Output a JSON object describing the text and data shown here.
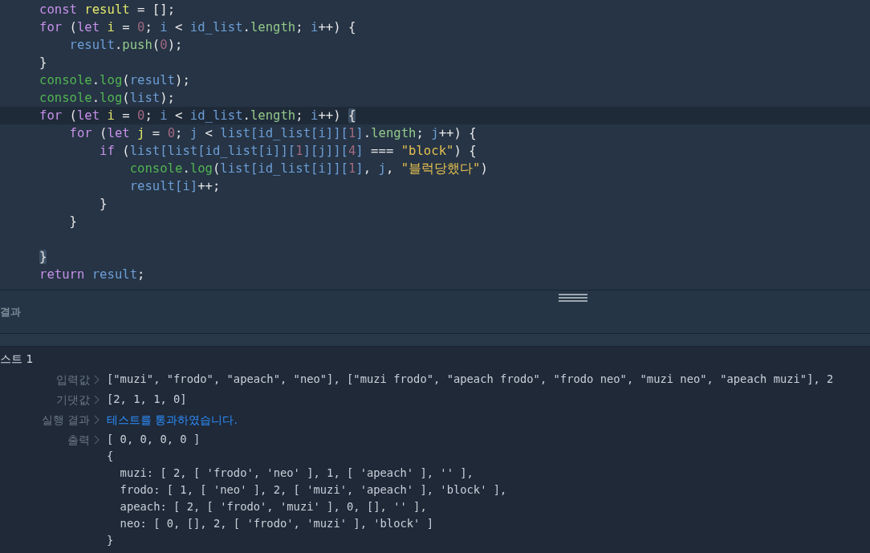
{
  "editor": {
    "lines": [
      {
        "active": false,
        "tokens": [
          {
            "kind": "kw",
            "text": "const "
          },
          {
            "kind": "decl",
            "text": "result"
          },
          {
            "kind": "op",
            "text": " = [];"
          }
        ]
      },
      {
        "active": false,
        "tokens": [
          {
            "kind": "kw",
            "text": "for"
          },
          {
            "kind": "op",
            "text": " ("
          },
          {
            "kind": "kw",
            "text": "let "
          },
          {
            "kind": "decl",
            "text": "i"
          },
          {
            "kind": "op",
            "text": " = "
          },
          {
            "kind": "num",
            "text": "0"
          },
          {
            "kind": "op",
            "text": "; "
          },
          {
            "kind": "id",
            "text": "i"
          },
          {
            "kind": "op",
            "text": " < "
          },
          {
            "kind": "id",
            "text": "id_list"
          },
          {
            "kind": "op",
            "text": "."
          },
          {
            "kind": "prop",
            "text": "length"
          },
          {
            "kind": "op",
            "text": "; "
          },
          {
            "kind": "id",
            "text": "i"
          },
          {
            "kind": "op",
            "text": "++) {"
          }
        ]
      },
      {
        "active": false,
        "tokens": [
          {
            "kind": "id",
            "text": "    result"
          },
          {
            "kind": "op",
            "text": "."
          },
          {
            "kind": "prop",
            "text": "push"
          },
          {
            "kind": "op",
            "text": "("
          },
          {
            "kind": "num",
            "text": "0"
          },
          {
            "kind": "op",
            "text": ");"
          }
        ]
      },
      {
        "active": false,
        "tokens": [
          {
            "kind": "op",
            "text": "}"
          }
        ]
      },
      {
        "active": false,
        "tokens": [
          {
            "kind": "fn",
            "text": "console"
          },
          {
            "kind": "op",
            "text": "."
          },
          {
            "kind": "fn",
            "text": "log"
          },
          {
            "kind": "op",
            "text": "("
          },
          {
            "kind": "id",
            "text": "result"
          },
          {
            "kind": "op",
            "text": ");"
          }
        ]
      },
      {
        "active": false,
        "tokens": [
          {
            "kind": "fn",
            "text": "console"
          },
          {
            "kind": "op",
            "text": "."
          },
          {
            "kind": "fn",
            "text": "log"
          },
          {
            "kind": "op",
            "text": "("
          },
          {
            "kind": "id",
            "text": "list"
          },
          {
            "kind": "op",
            "text": ");"
          }
        ]
      },
      {
        "active": true,
        "tokens": [
          {
            "kind": "kw",
            "text": "for"
          },
          {
            "kind": "op",
            "text": " ("
          },
          {
            "kind": "kw",
            "text": "let "
          },
          {
            "kind": "decl",
            "text": "i"
          },
          {
            "kind": "op",
            "text": " = "
          },
          {
            "kind": "num",
            "text": "0"
          },
          {
            "kind": "op",
            "text": "; "
          },
          {
            "kind": "id",
            "text": "i"
          },
          {
            "kind": "op",
            "text": " < "
          },
          {
            "kind": "id",
            "text": "id_list"
          },
          {
            "kind": "op",
            "text": "."
          },
          {
            "kind": "prop",
            "text": "length"
          },
          {
            "kind": "op",
            "text": "; "
          },
          {
            "kind": "id",
            "text": "i"
          },
          {
            "kind": "op",
            "text": "++) "
          },
          {
            "kind": "match",
            "text": "{"
          }
        ]
      },
      {
        "active": false,
        "tokens": [
          {
            "kind": "kw",
            "text": "    for"
          },
          {
            "kind": "op",
            "text": " ("
          },
          {
            "kind": "kw",
            "text": "let "
          },
          {
            "kind": "decl",
            "text": "j"
          },
          {
            "kind": "op",
            "text": " = "
          },
          {
            "kind": "num",
            "text": "0"
          },
          {
            "kind": "op",
            "text": "; "
          },
          {
            "kind": "id",
            "text": "j"
          },
          {
            "kind": "op",
            "text": " < "
          },
          {
            "kind": "id",
            "text": "list[id_list[i]]["
          },
          {
            "kind": "num",
            "text": "1"
          },
          {
            "kind": "id",
            "text": "]"
          },
          {
            "kind": "op",
            "text": "."
          },
          {
            "kind": "prop",
            "text": "length"
          },
          {
            "kind": "op",
            "text": "; "
          },
          {
            "kind": "id",
            "text": "j"
          },
          {
            "kind": "op",
            "text": "++) {"
          }
        ]
      },
      {
        "active": false,
        "tokens": [
          {
            "kind": "kw",
            "text": "        if"
          },
          {
            "kind": "op",
            "text": " ("
          },
          {
            "kind": "id",
            "text": "list[list[id_list[i]]["
          },
          {
            "kind": "num",
            "text": "1"
          },
          {
            "kind": "id",
            "text": "][j]]["
          },
          {
            "kind": "num",
            "text": "4"
          },
          {
            "kind": "id",
            "text": "]"
          },
          {
            "kind": "op",
            "text": " === "
          },
          {
            "kind": "str",
            "text": "\"block\""
          },
          {
            "kind": "op",
            "text": ") {"
          }
        ]
      },
      {
        "active": false,
        "tokens": [
          {
            "kind": "fn",
            "text": "            console"
          },
          {
            "kind": "op",
            "text": "."
          },
          {
            "kind": "fn",
            "text": "log"
          },
          {
            "kind": "op",
            "text": "("
          },
          {
            "kind": "id",
            "text": "list[id_list[i]]["
          },
          {
            "kind": "num",
            "text": "1"
          },
          {
            "kind": "id",
            "text": "]"
          },
          {
            "kind": "op",
            "text": ", "
          },
          {
            "kind": "id",
            "text": "j"
          },
          {
            "kind": "op",
            "text": ", "
          },
          {
            "kind": "str",
            "text": "\"블럭당했다\""
          },
          {
            "kind": "op",
            "text": ")"
          }
        ]
      },
      {
        "active": false,
        "tokens": [
          {
            "kind": "id",
            "text": "            result[i]"
          },
          {
            "kind": "op",
            "text": "++;"
          }
        ]
      },
      {
        "active": false,
        "tokens": [
          {
            "kind": "op",
            "text": "        }"
          }
        ]
      },
      {
        "active": false,
        "blank_after": true,
        "tokens": [
          {
            "kind": "op",
            "text": "    }"
          }
        ]
      },
      {
        "active": false,
        "tokens": [
          {
            "kind": "match",
            "text": "}"
          }
        ]
      },
      {
        "active": false,
        "tokens": [
          {
            "kind": "kw",
            "text": "return "
          },
          {
            "kind": "id",
            "text": "result"
          },
          {
            "kind": "op",
            "text": ";"
          }
        ]
      }
    ]
  },
  "result_panel": {
    "title": "결과"
  },
  "test_case": {
    "title": "스트 1",
    "rows": [
      {
        "label": "입력값",
        "kind": "code",
        "lines": [
          "[\"muzi\", \"frodo\", \"apeach\", \"neo\"], [\"muzi frodo\", \"apeach frodo\", \"frodo neo\", \"muzi neo\", \"apeach muzi\"], 2"
        ]
      },
      {
        "label": "기댓값",
        "kind": "code",
        "lines": [
          "[2, 1, 1, 0]"
        ]
      },
      {
        "label": "실행 결과",
        "kind": "pass",
        "lines": [
          "테스트를 통과하였습니다."
        ]
      },
      {
        "label": "출력",
        "kind": "code",
        "lines": [
          "[ 0, 0, 0, 0 ]",
          "{",
          "  muzi: [ 2, [ 'frodo', 'neo' ], 1, [ 'apeach' ], '' ],",
          "  frodo: [ 1, [ 'neo' ], 2, [ 'muzi', 'apeach' ], 'block' ],",
          "  apeach: [ 2, [ 'frodo', 'muzi' ], 0, [], '' ],",
          "  neo: [ 0, [], 2, [ 'frodo', 'muzi' ], 'block' ]",
          "}"
        ]
      }
    ]
  }
}
